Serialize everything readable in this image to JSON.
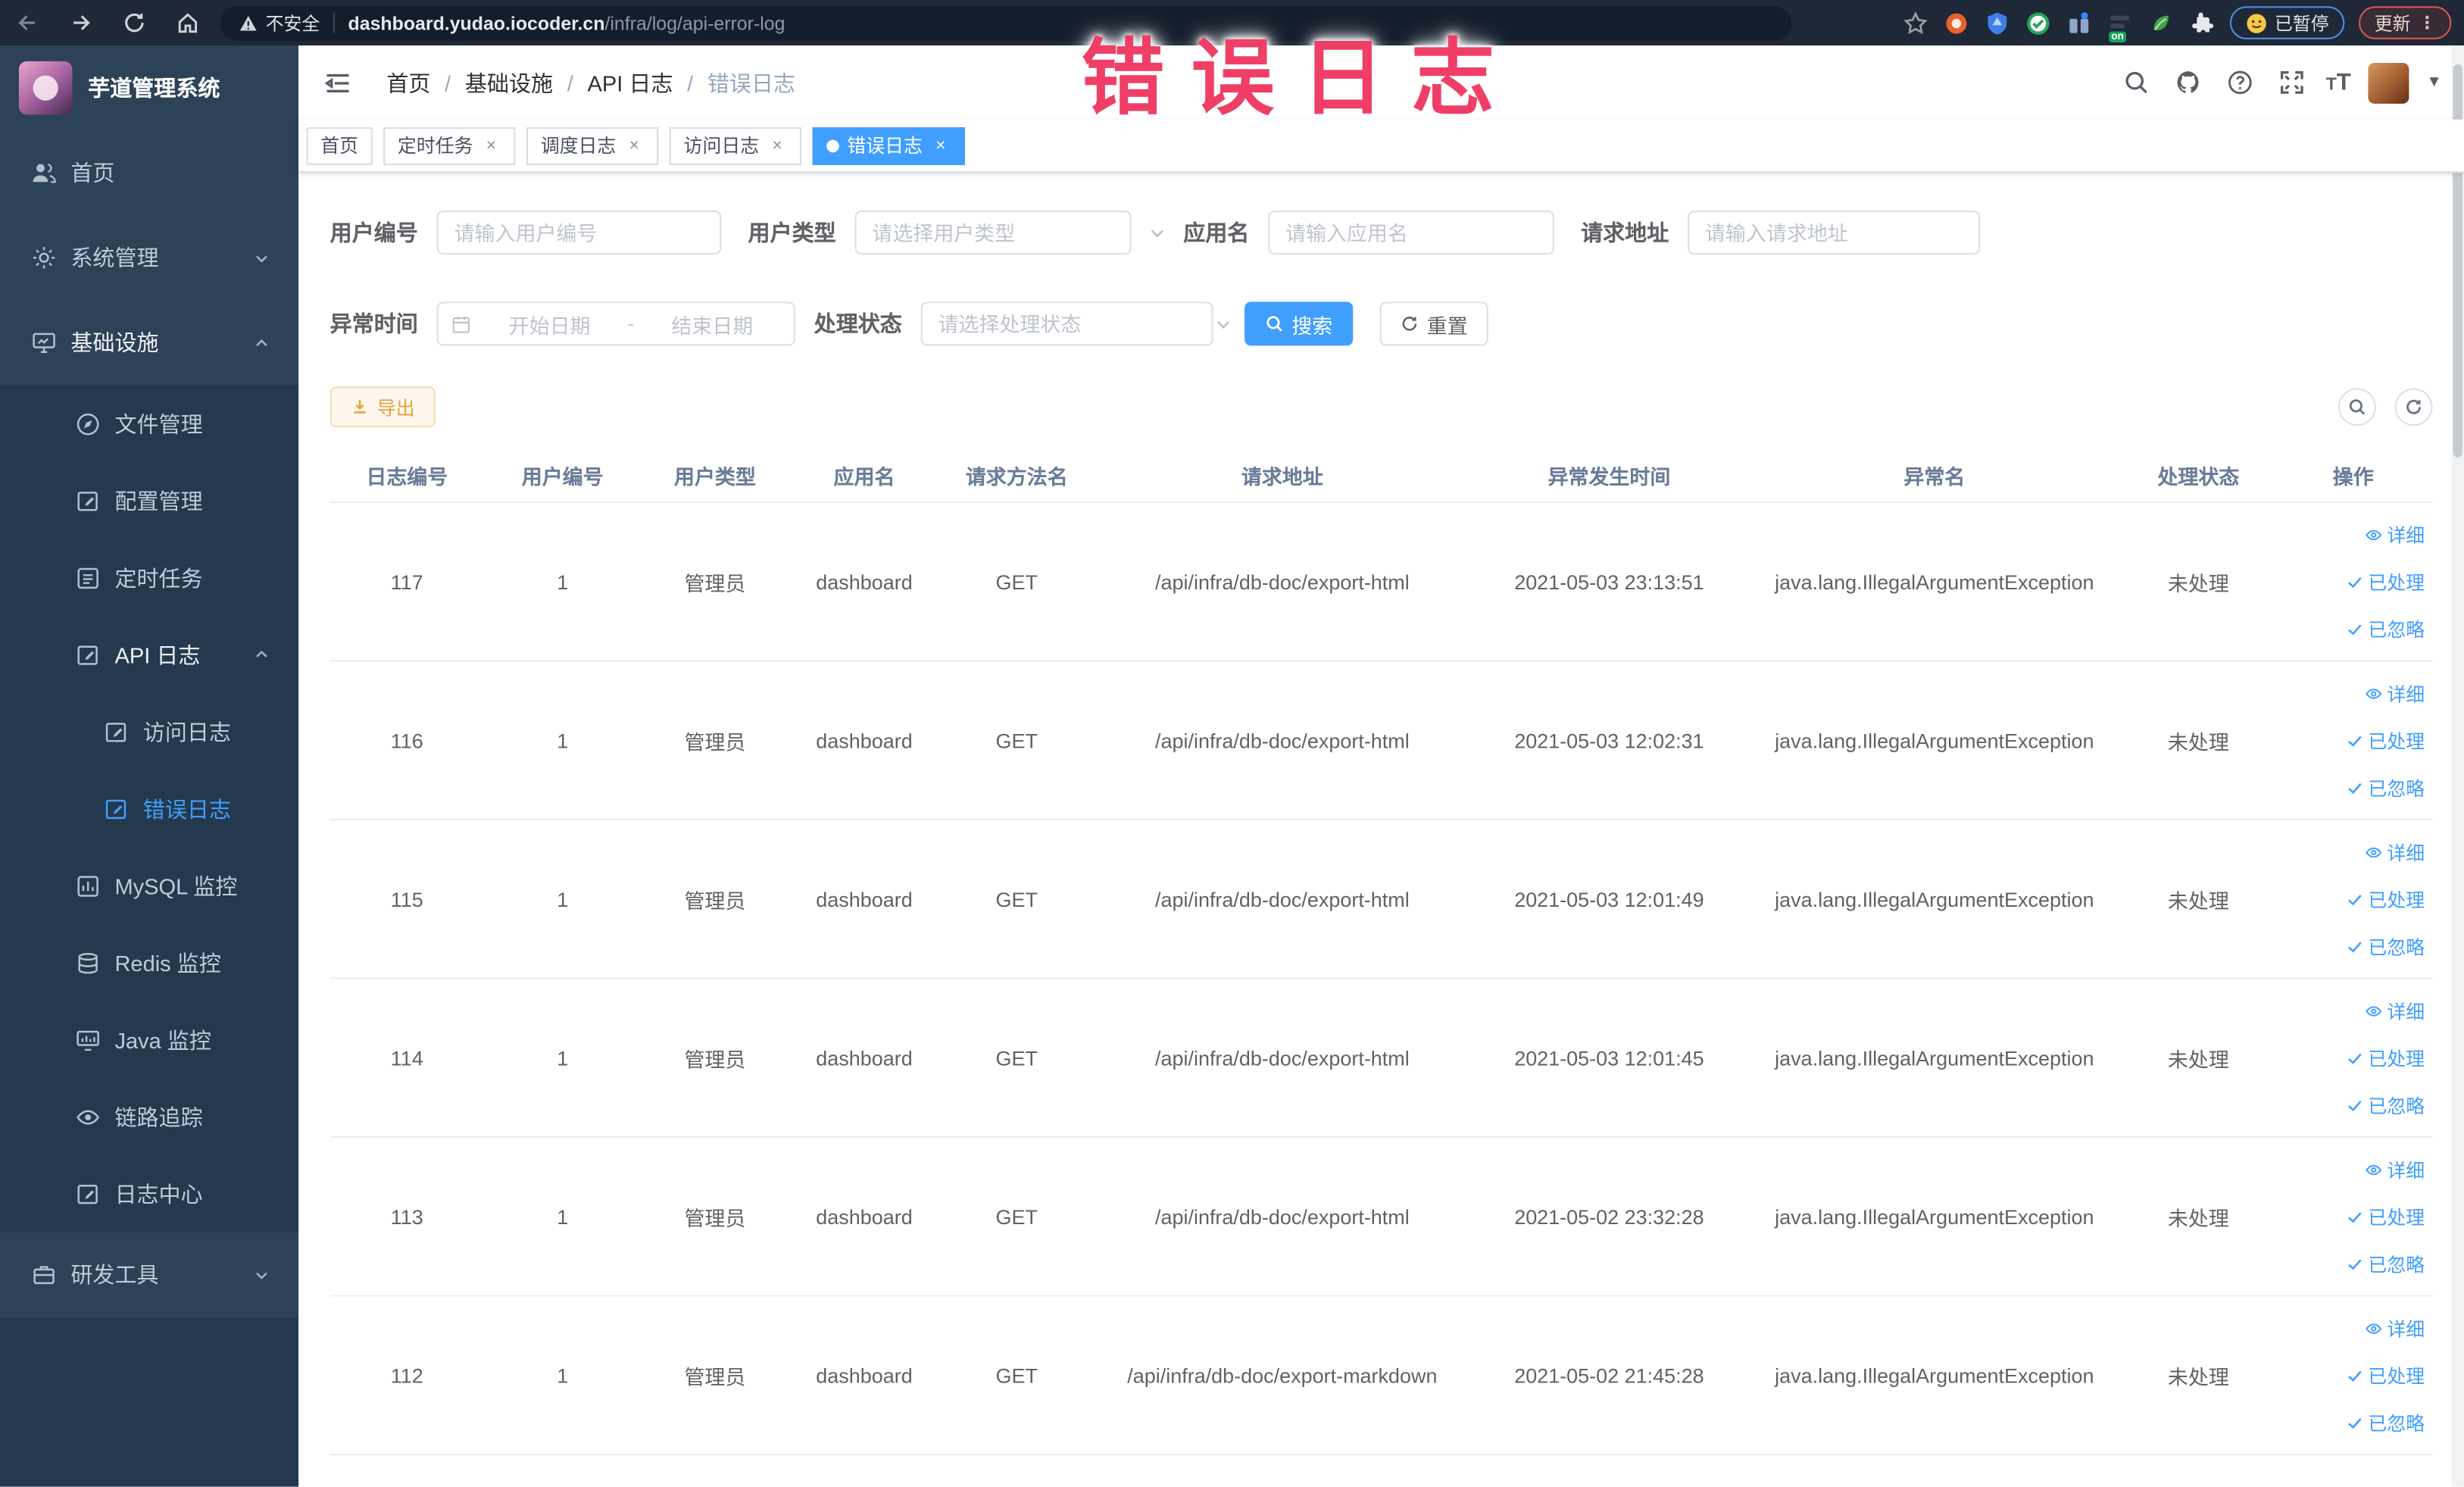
{
  "browser": {
    "security_label": "不安全",
    "url_host": "dashboard.yudao.iocoder.cn",
    "url_path": "/infra/log/api-error-log",
    "extension_on_badge": "on",
    "profile_chip_label": "已暂停",
    "update_chip_label": "更新"
  },
  "overlay": {
    "title": "错误日志"
  },
  "sidebar": {
    "logo_title": "芋道管理系统",
    "items": [
      {
        "label": "首页"
      },
      {
        "label": "系统管理"
      },
      {
        "label": "基础设施"
      },
      {
        "label": "文件管理"
      },
      {
        "label": "配置管理"
      },
      {
        "label": "定时任务"
      },
      {
        "label": "API 日志"
      },
      {
        "label": "访问日志"
      },
      {
        "label": "错误日志"
      },
      {
        "label": "MySQL 监控"
      },
      {
        "label": "Redis 监控"
      },
      {
        "label": "Java 监控"
      },
      {
        "label": "链路追踪"
      },
      {
        "label": "日志中心"
      },
      {
        "label": "研发工具"
      }
    ]
  },
  "navbar": {
    "breadcrumbs": [
      "首页",
      "基础设施",
      "API 日志",
      "错误日志"
    ]
  },
  "tags": [
    {
      "label": "首页"
    },
    {
      "label": "定时任务"
    },
    {
      "label": "调度日志"
    },
    {
      "label": "访问日志"
    },
    {
      "label": "错误日志"
    }
  ],
  "filters": {
    "user_id_label": "用户编号",
    "user_id_placeholder": "请输入用户编号",
    "user_type_label": "用户类型",
    "user_type_placeholder": "请选择用户类型",
    "app_name_label": "应用名",
    "app_name_placeholder": "请输入应用名",
    "request_url_label": "请求地址",
    "request_url_placeholder": "请输入请求地址",
    "exception_time_label": "异常时间",
    "start_date_placeholder": "开始日期",
    "range_separator": "-",
    "end_date_placeholder": "结束日期",
    "process_status_label": "处理状态",
    "process_status_placeholder": "请选择处理状态",
    "search_label": "搜索",
    "reset_label": "重置"
  },
  "toolbar": {
    "export_label": "导出"
  },
  "table": {
    "columns": [
      "日志编号",
      "用户编号",
      "用户类型",
      "应用名",
      "请求方法名",
      "请求地址",
      "异常发生时间",
      "异常名",
      "处理状态",
      "操作"
    ],
    "actions": [
      "详细",
      "已处理",
      "已忽略"
    ],
    "rows": [
      {
        "id": "117",
        "user_id": "1",
        "user_type": "管理员",
        "app": "dashboard",
        "method": "GET",
        "url": "/api/infra/db-doc/export-html",
        "time": "2021-05-03 23:13:51",
        "exception": "java.lang.IllegalArgumentException",
        "status": "未处理"
      },
      {
        "id": "116",
        "user_id": "1",
        "user_type": "管理员",
        "app": "dashboard",
        "method": "GET",
        "url": "/api/infra/db-doc/export-html",
        "time": "2021-05-03 12:02:31",
        "exception": "java.lang.IllegalArgumentException",
        "status": "未处理"
      },
      {
        "id": "115",
        "user_id": "1",
        "user_type": "管理员",
        "app": "dashboard",
        "method": "GET",
        "url": "/api/infra/db-doc/export-html",
        "time": "2021-05-03 12:01:49",
        "exception": "java.lang.IllegalArgumentException",
        "status": "未处理"
      },
      {
        "id": "114",
        "user_id": "1",
        "user_type": "管理员",
        "app": "dashboard",
        "method": "GET",
        "url": "/api/infra/db-doc/export-html",
        "time": "2021-05-03 12:01:45",
        "exception": "java.lang.IllegalArgumentException",
        "status": "未处理"
      },
      {
        "id": "113",
        "user_id": "1",
        "user_type": "管理员",
        "app": "dashboard",
        "method": "GET",
        "url": "/api/infra/db-doc/export-html",
        "time": "2021-05-02 23:32:28",
        "exception": "java.lang.IllegalArgumentException",
        "status": "未处理"
      },
      {
        "id": "112",
        "user_id": "1",
        "user_type": "管理员",
        "app": "dashboard",
        "method": "GET",
        "url": "/api/infra/db-doc/export-markdown",
        "time": "2021-05-02 21:45:28",
        "exception": "java.lang.IllegalArgumentException",
        "status": "未处理"
      }
    ]
  },
  "colors": {
    "accent": "#409eff",
    "warning": "#e6a23c",
    "sidebar_bg": "#2d4256",
    "submenu_bg": "#24394d",
    "overlay_pink": "#ef3f66"
  }
}
